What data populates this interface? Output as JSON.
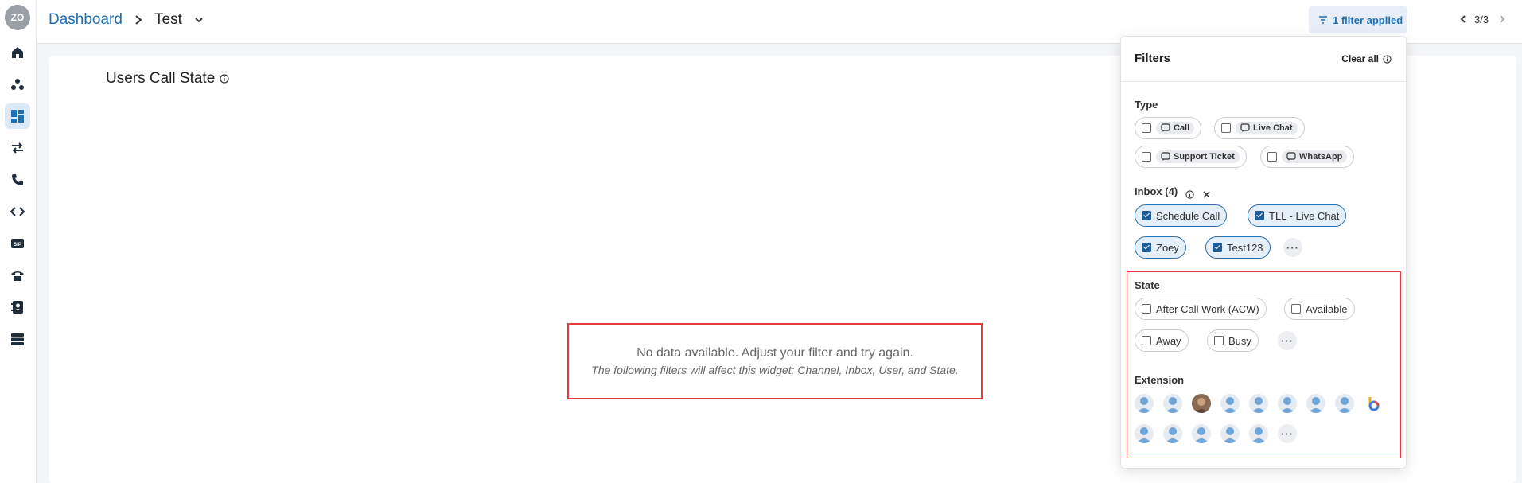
{
  "user": {
    "initials": "ZO"
  },
  "header": {
    "breadcrumb_root": "Dashboard",
    "breadcrumb_current": "Test",
    "filter_button": "1 filter applied",
    "pager": "3/3"
  },
  "widget": {
    "title": "Users Call State",
    "empty_message": "No data available. Adjust your filter and try again.",
    "empty_hint": "The following filters will affect this widget: Channel, Inbox, User, and State."
  },
  "filters": {
    "title": "Filters",
    "clear_all": "Clear all",
    "type": {
      "label": "Type",
      "options": [
        {
          "label": "Call",
          "checked": false
        },
        {
          "label": "Live Chat",
          "checked": false
        },
        {
          "label": "Support Ticket",
          "checked": false
        },
        {
          "label": "WhatsApp",
          "checked": false
        }
      ]
    },
    "inbox": {
      "label": "Inbox (4)",
      "options": [
        {
          "label": "Schedule Call",
          "checked": true
        },
        {
          "label": "TLL - Live Chat",
          "checked": true
        },
        {
          "label": "Zoey",
          "checked": true
        },
        {
          "label": "Test123",
          "checked": true
        }
      ]
    },
    "state": {
      "label": "State",
      "options": [
        {
          "label": "After Call Work (ACW)",
          "checked": false
        },
        {
          "label": "Available",
          "checked": false
        },
        {
          "label": "Away",
          "checked": false
        },
        {
          "label": "Busy",
          "checked": false
        }
      ]
    },
    "extension": {
      "label": "Extension"
    },
    "more": "···"
  },
  "colors": {
    "accent": "#1f6fb5",
    "highlight_border": "#e23b3b",
    "checked_chip_bg": "#e5eff9"
  }
}
